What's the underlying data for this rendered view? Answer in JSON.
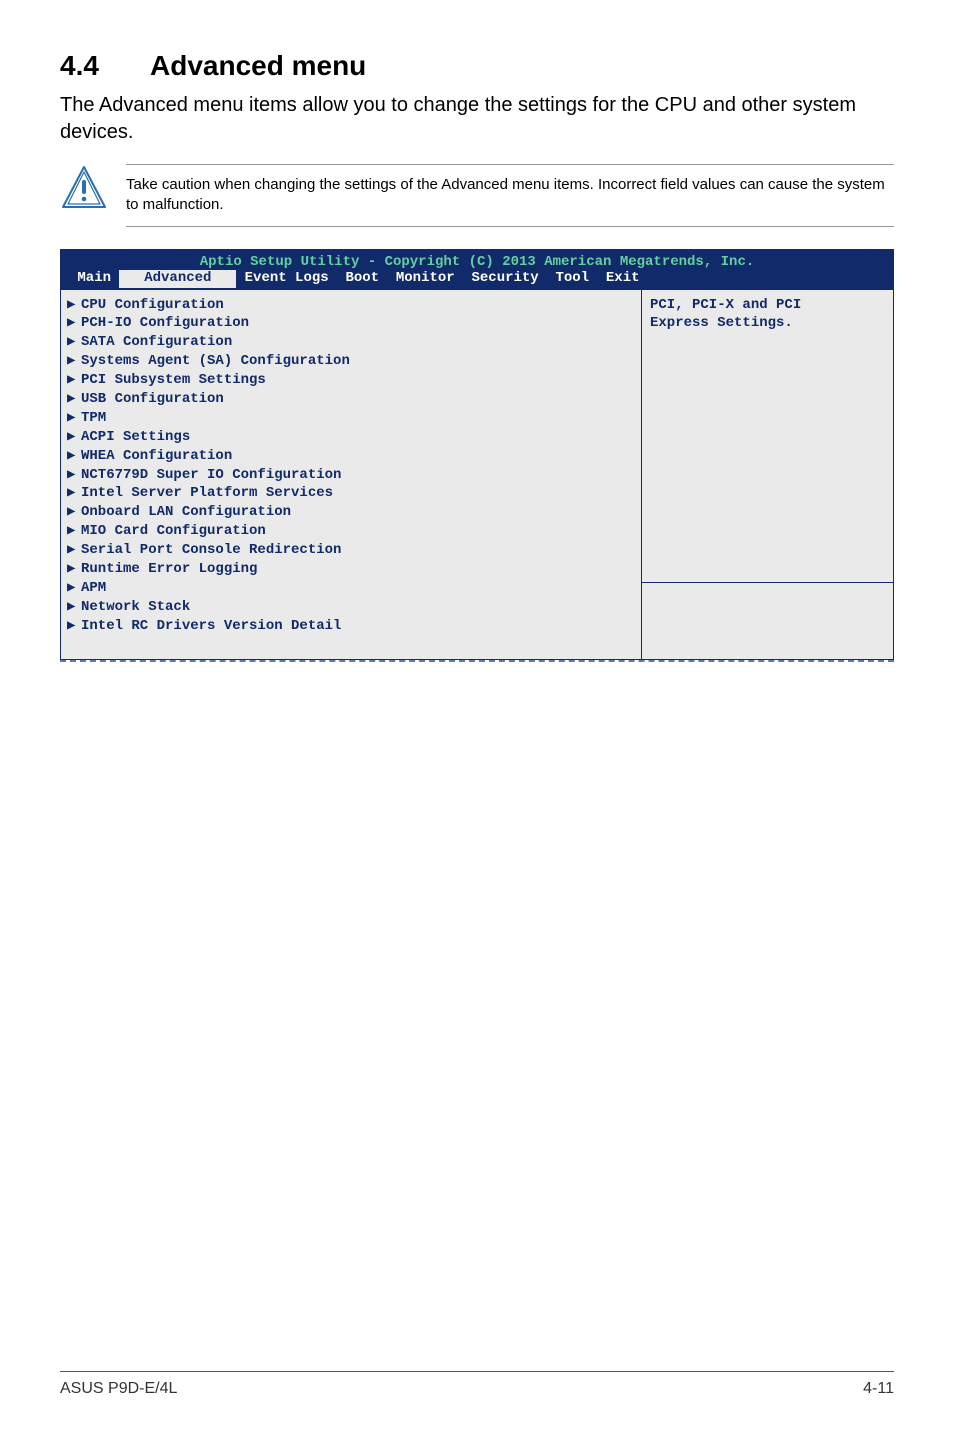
{
  "heading": {
    "number": "4.4",
    "title": "Advanced menu"
  },
  "intro": "The Advanced menu items allow you to change the settings for the CPU and other system devices.",
  "caution": "Take caution when changing the settings of the Advanced menu items. Incorrect field values can cause the system to malfunction.",
  "bios": {
    "title": "Aptio Setup Utility - Copyright (C) 2013 American Megatrends, Inc.",
    "tabs": {
      "inactive_left": " Main ",
      "active": " Advanced ",
      "inactive_right": " Event Logs  Boot  Monitor  Security  Tool  Exit"
    },
    "menu": [
      "CPU Configuration",
      "PCH-IO Configuration",
      "SATA Configuration",
      "Systems Agent (SA) Configuration",
      "PCI Subsystem Settings",
      "USB Configuration",
      "TPM",
      "ACPI Settings",
      "WHEA Configuration",
      "NCT6779D Super IO Configuration",
      "Intel Server Platform Services",
      "Onboard LAN Configuration",
      "MIO Card Configuration",
      "Serial Port Console Redirection",
      "Runtime Error Logging",
      "APM",
      "Network Stack",
      "Intel RC Drivers Version Detail"
    ],
    "help_line1": "PCI, PCI-X and PCI",
    "help_line2": "Express Settings."
  },
  "footer": {
    "left": "ASUS P9D-E/4L",
    "right": "4-11"
  },
  "icons": {
    "arrow": "▶"
  }
}
